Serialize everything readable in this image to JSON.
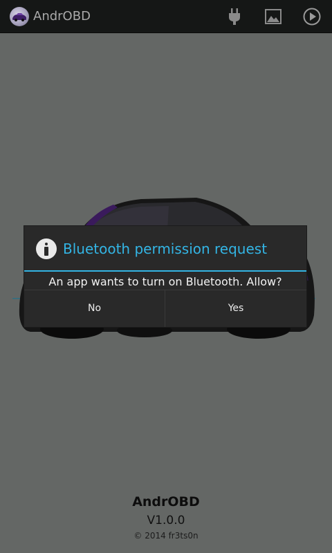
{
  "colors": {
    "background": "#646765",
    "action_bar": "#151716",
    "accent": "#33b5e5",
    "dialog": "#292929",
    "car_accent": "#5a2a8a"
  },
  "action_bar": {
    "title": "AndrOBD",
    "app_icon": "car-logo-icon",
    "actions": [
      {
        "name": "plug-icon"
      },
      {
        "name": "image-icon"
      },
      {
        "name": "play-icon"
      }
    ]
  },
  "illustration": {
    "name": "car-illustration"
  },
  "dialog": {
    "icon": "info-icon",
    "title": "Bluetooth permission request",
    "message": "An app wants to turn on Bluetooth. Allow?",
    "buttons": {
      "no": "No",
      "yes": "Yes"
    }
  },
  "footer": {
    "app_name": "AndrOBD",
    "version": "V1.0.0",
    "copyright": "© 2014 fr3ts0n"
  }
}
